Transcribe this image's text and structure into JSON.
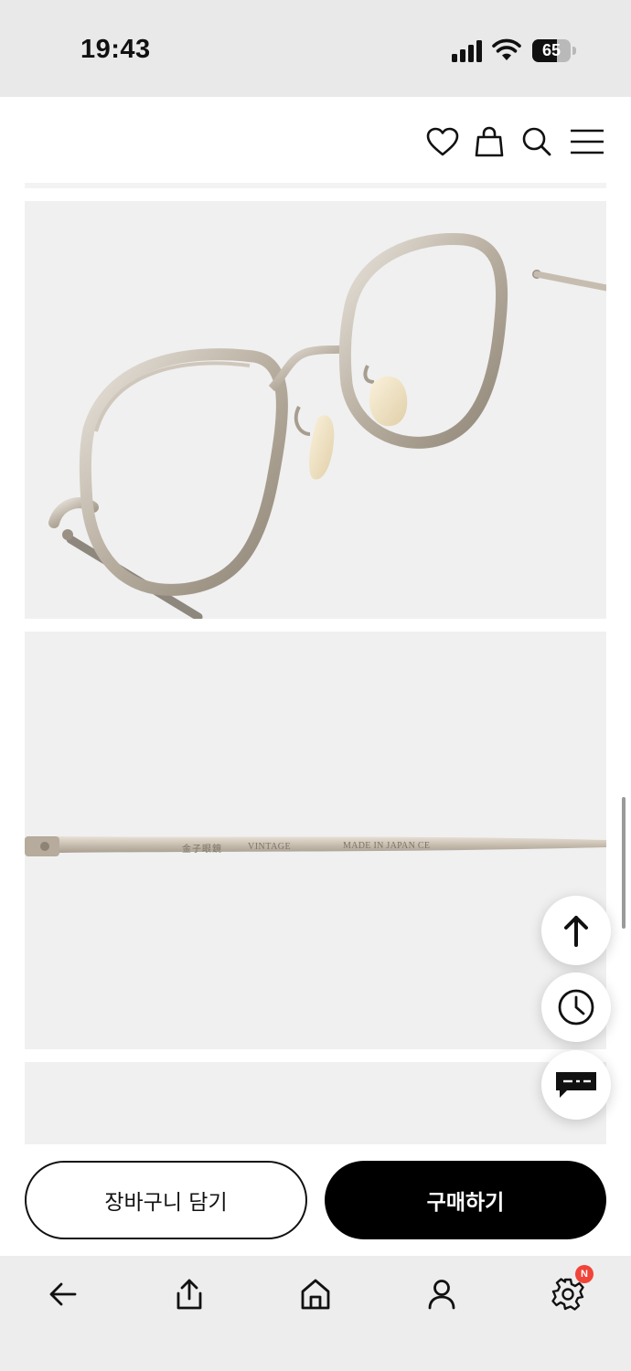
{
  "status_bar": {
    "time": "19:43",
    "battery_level": "65",
    "battery_fraction": 0.65,
    "icons": [
      "signal-icon",
      "wifi-icon",
      "battery-icon"
    ]
  },
  "header": {
    "icons": [
      "heart-icon",
      "shopping-bag-icon",
      "search-icon",
      "menu-icon"
    ]
  },
  "product": {
    "temple_engraving": {
      "kanji": "金子眼鏡",
      "model": "VINTAGE",
      "origin": "MADE IN JAPAN CE"
    }
  },
  "floating_buttons": [
    "arrow-up-icon",
    "clock-icon",
    "chat-icon"
  ],
  "purchase_bar": {
    "cart_label": "장바구니 담기",
    "buy_label": "구매하기"
  },
  "bottom_nav": {
    "icons": [
      "back-arrow-icon",
      "share-icon",
      "home-icon",
      "user-icon",
      "settings-icon"
    ],
    "settings_badge": "N",
    "colors": {
      "badge": "#f04438"
    }
  }
}
